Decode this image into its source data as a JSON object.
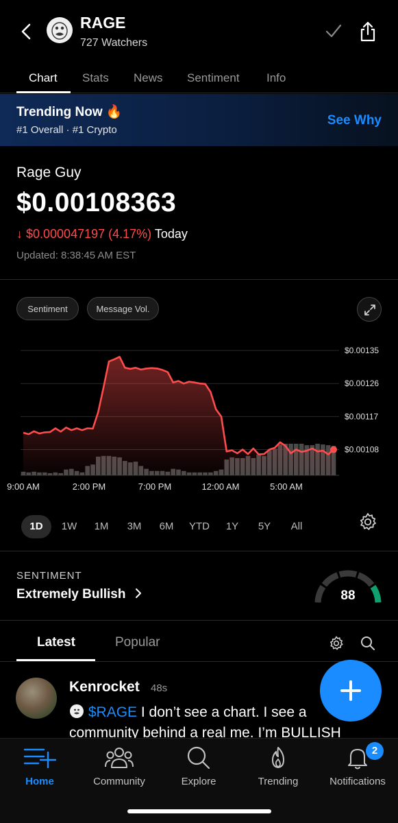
{
  "header": {
    "symbol": "RAGE",
    "watchers": "727 Watchers"
  },
  "tabs": [
    "Chart",
    "Stats",
    "News",
    "Sentiment",
    "Info"
  ],
  "trending": {
    "title": "Trending Now 🔥",
    "subtitle": "#1 Overall  ·  #1 Crypto",
    "action": "See Why"
  },
  "price_block": {
    "name": "Rage Guy",
    "price": "$0.00108363",
    "change": "↓ $0.000047197 (4.17%)",
    "change_suffix": "Today",
    "updated": "Updated: 8:38:45 AM EST"
  },
  "chart_controls": {
    "chip_sentiment": "Sentiment",
    "chip_message_vol": "Message Vol."
  },
  "chart_data": {
    "type": "line",
    "y_ticks": [
      "$0.00135",
      "$0.00126",
      "$0.00117",
      "$0.00108"
    ],
    "x_ticks": [
      "9:00 AM",
      "2:00 PM",
      "7:00 PM",
      "12:00 AM",
      "5:00 AM"
    ],
    "ylim": [
      0.00101,
      0.00138
    ],
    "price": [
      0.001126,
      0.001122,
      0.00113,
      0.001124,
      0.001127,
      0.001128,
      0.001138,
      0.001129,
      0.00114,
      0.001133,
      0.001138,
      0.001133,
      0.001138,
      0.001137,
      0.001182,
      0.00125,
      0.00132,
      0.001326,
      0.001333,
      0.001303,
      0.0013,
      0.001303,
      0.001298,
      0.001301,
      0.001302,
      0.001301,
      0.001297,
      0.001291,
      0.001263,
      0.001267,
      0.00126,
      0.001265,
      0.001263,
      0.00126,
      0.001259,
      0.001237,
      0.00119,
      0.00117,
      0.001075,
      0.001078,
      0.00107,
      0.00108,
      0.001068,
      0.001083,
      0.001067,
      0.001068,
      0.00108,
      0.001085,
      0.0011,
      0.00109,
      0.00107,
      0.00108,
      0.001074,
      0.001077,
      0.001083,
      0.001075,
      0.001077,
      0.001067,
      0.00108
    ],
    "volume": [
      5,
      4,
      5,
      4,
      4,
      3,
      4,
      3,
      8,
      9,
      6,
      4,
      13,
      15,
      26,
      27,
      27,
      26,
      25,
      20,
      18,
      19,
      13,
      9,
      6,
      6,
      6,
      5,
      9,
      8,
      6,
      4,
      4,
      4,
      4,
      4,
      6,
      8,
      22,
      25,
      24,
      24,
      27,
      24,
      29,
      27,
      35,
      37,
      43,
      44,
      44,
      44,
      44,
      42,
      42,
      44,
      43,
      42,
      41
    ]
  },
  "ranges": [
    "1D",
    "1W",
    "1M",
    "3M",
    "6M",
    "YTD",
    "1Y",
    "5Y",
    "All"
  ],
  "sentiment": {
    "label": "SENTIMENT",
    "value": "Extremely Bullish",
    "score": "88",
    "score_fraction": 0.88,
    "bullish_color": "#0ea06e"
  },
  "feed": {
    "tab_latest": "Latest",
    "tab_popular": "Popular"
  },
  "post": {
    "author": "Kenrocket",
    "time": "48s",
    "cashtag": "$RAGE",
    "text": " I don’t see a chart. I see a community behind a real me. I’m BULLISH"
  },
  "bottom_nav": [
    {
      "label": "Home",
      "icon": "home-icon"
    },
    {
      "label": "Community",
      "icon": "community-icon"
    },
    {
      "label": "Explore",
      "icon": "search-icon"
    },
    {
      "label": "Trending",
      "icon": "flame-icon"
    },
    {
      "label": "Notifications",
      "icon": "bell-icon"
    }
  ],
  "notifications_badge": "2",
  "colors": {
    "accent": "#1a8cff",
    "negative": "#ff4d4d",
    "chart_line": "#ff4d4d"
  }
}
